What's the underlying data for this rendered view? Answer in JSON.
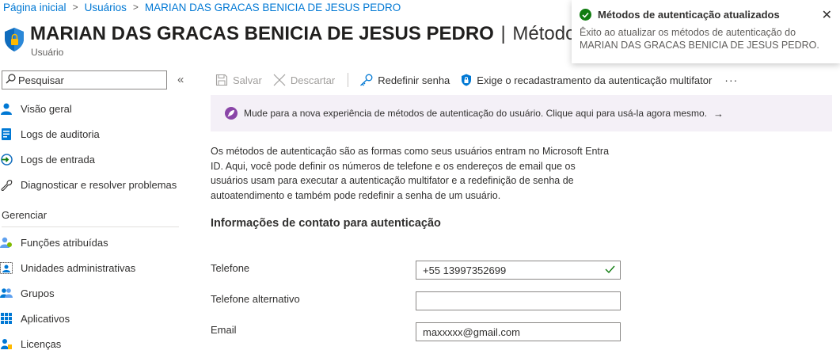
{
  "breadcrumb": {
    "items": [
      "Página inicial",
      "Usuários",
      "MARIAN DAS GRACAS BENICIA DE JESUS PEDRO"
    ]
  },
  "header": {
    "name": "MARIAN DAS GRACAS BENICIA DE JESUS PEDRO",
    "separator": "|",
    "section": "Métodos de",
    "subtitle": "Usuário"
  },
  "sidebar": {
    "search_placeholder": "Pesquisar",
    "collapse": "«",
    "items": [
      {
        "label": "Visão geral",
        "icon": "person-icon"
      },
      {
        "label": "Logs de auditoria",
        "icon": "audit-log-icon"
      },
      {
        "label": "Logs de entrada",
        "icon": "sign-in-log-icon"
      },
      {
        "label": "Diagnosticar e resolver problemas",
        "icon": "wrench-icon"
      }
    ],
    "section_label": "Gerenciar",
    "manage_items": [
      {
        "label": "Funções atribuídas",
        "icon": "roles-icon"
      },
      {
        "label": "Unidades administrativas",
        "icon": "admin-units-icon"
      },
      {
        "label": "Grupos",
        "icon": "groups-icon"
      },
      {
        "label": "Aplicativos",
        "icon": "apps-icon"
      },
      {
        "label": "Licenças",
        "icon": "license-icon"
      }
    ]
  },
  "toolbar": {
    "save": "Salvar",
    "discard": "Descartar",
    "reset_password": "Redefinir senha",
    "require_mfa": "Exige o recadastramento da autenticação multifator",
    "more": "···"
  },
  "banner": {
    "text": "Mude para a nova experiência de métodos de autenticação do usuário. Clique aqui para usá-la agora mesmo.",
    "arrow": "→"
  },
  "description": "Os métodos de autenticação são as formas como seus usuários entram no Microsoft Entra ID. Aqui, você pode definir os números de telefone e os endereços de email que os usuários usam para executar a autenticação multifator e a redefinição de senha de autoatendimento e também pode redefinir a senha de um usuário.",
  "contact": {
    "title": "Informações de contato para autenticação",
    "phone_label": "Telefone",
    "phone_value": "+55 13997352699",
    "alt_phone_label": "Telefone alternativo",
    "alt_phone_value": "",
    "email_label": "Email",
    "email_value": "maxxxxx@gmail.com"
  },
  "toast": {
    "title": "Métodos de autenticação atualizados",
    "body": "Êxito ao atualizar os métodos de autenticação do MARIAN DAS GRACAS BENICIA DE JESUS PEDRO.",
    "close": "✕"
  },
  "colors": {
    "link": "#0078d4",
    "success": "#107c10",
    "banner_bg": "#f4f0f7",
    "banner_icon": "#8a46a8"
  }
}
